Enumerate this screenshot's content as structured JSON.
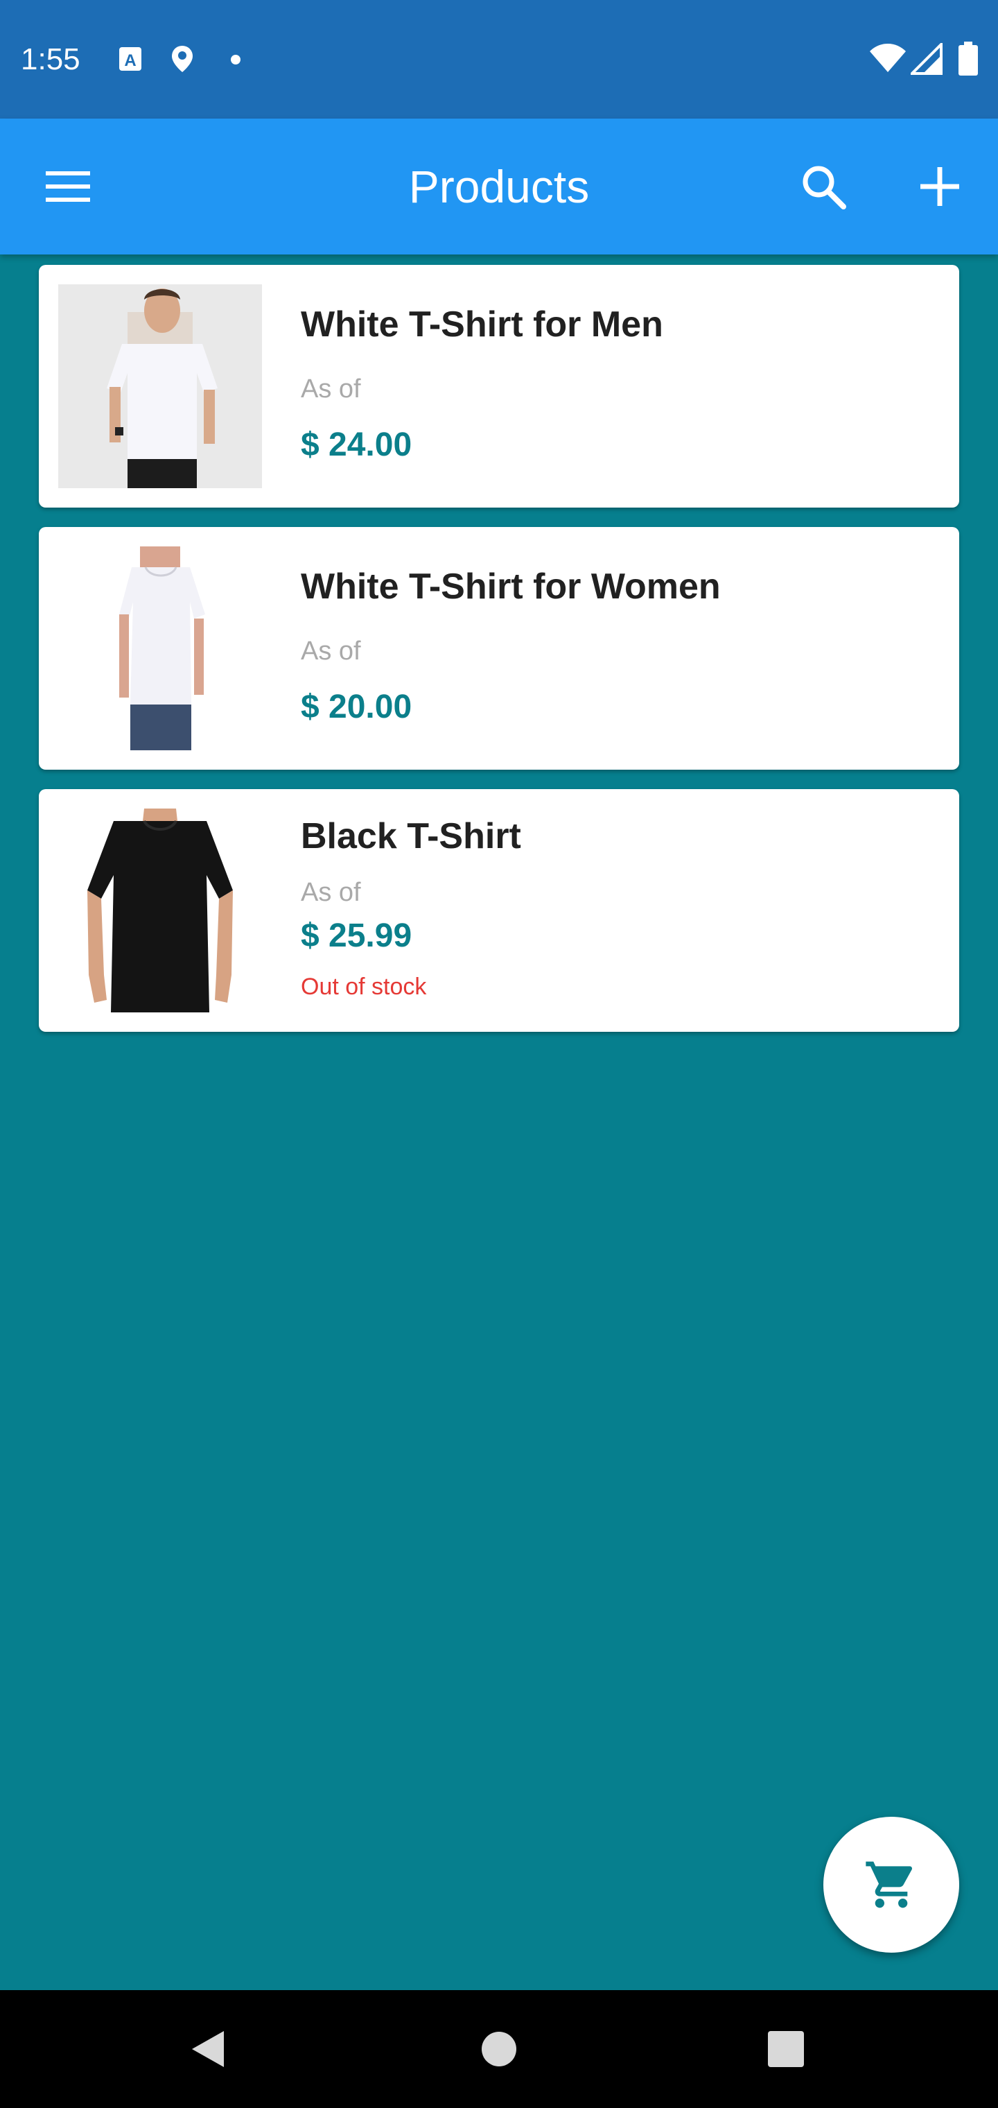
{
  "status_bar": {
    "time": "1:55",
    "icons": [
      "keyboard-a-icon",
      "location-pin-icon",
      "dot-icon",
      "wifi-icon",
      "cell-signal-icon",
      "battery-icon"
    ]
  },
  "app_bar": {
    "title": "Products",
    "menu_icon": "hamburger-menu-icon",
    "search_icon": "search-icon",
    "add_icon": "plus-icon"
  },
  "products": [
    {
      "name": "White T-Shirt for Men",
      "as_of": "As of",
      "price": "$ 24.00",
      "stock_status": "",
      "image": "white-tshirt-men-photo"
    },
    {
      "name": "White T-Shirt for Women",
      "as_of": "As of",
      "price": "$ 20.00",
      "stock_status": "",
      "image": "white-tshirt-women-photo"
    },
    {
      "name": "Black T-Shirt",
      "as_of": "As of",
      "price": "$ 25.99",
      "stock_status": "Out of stock",
      "image": "black-tshirt-photo"
    }
  ],
  "fab": {
    "icon": "shopping-cart-icon"
  },
  "nav_bar": {
    "icons": [
      "back-triangle-icon",
      "home-circle-icon",
      "recents-square-icon"
    ]
  },
  "colors": {
    "status_bar": "#1d6db5",
    "app_bar": "#2196f3",
    "background": "#067f8e",
    "price": "#0b7f8b",
    "out_of_stock": "#e53935"
  }
}
